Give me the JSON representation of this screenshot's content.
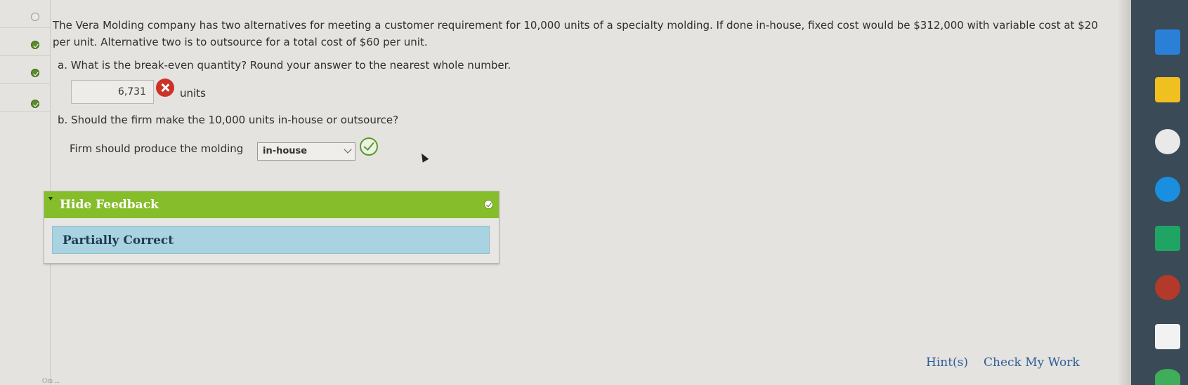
{
  "question": {
    "text": "The Vera Molding company has two alternatives for meeting a customer requirement for 10,000 units of a specialty molding. If done in-house, fixed cost would be $312,000 with variable cost at $20 per unit. Alternative two is to outsource for a total cost of $60 per unit.",
    "part_a_prompt": "a. What is the break-even quantity? Round your answer to the nearest whole number.",
    "part_a_answer": "6,731",
    "part_a_units": "units",
    "part_b_prompt": "b. Should the firm make the 10,000 units in-house or outsource?",
    "part_b_label": "Firm should produce the molding",
    "part_b_selected": "in-house"
  },
  "feedback": {
    "toggle_label": "Hide Feedback",
    "status": "Partially Correct"
  },
  "footer": {
    "hints": "Hint(s)",
    "check_my_work": "Check My Work"
  },
  "rail": {
    "bottom_text": "Om ..."
  },
  "colors": {
    "feedback_header": "#86bd2a",
    "feedback_status": "#a9d3e0",
    "incorrect": "#cc3228",
    "correct": "#5a9a2a",
    "link": "#2f5d9a"
  },
  "icons": [
    "incorrect-x-icon",
    "correct-check-icon",
    "chevron-down-icon",
    "step-status-icon"
  ]
}
